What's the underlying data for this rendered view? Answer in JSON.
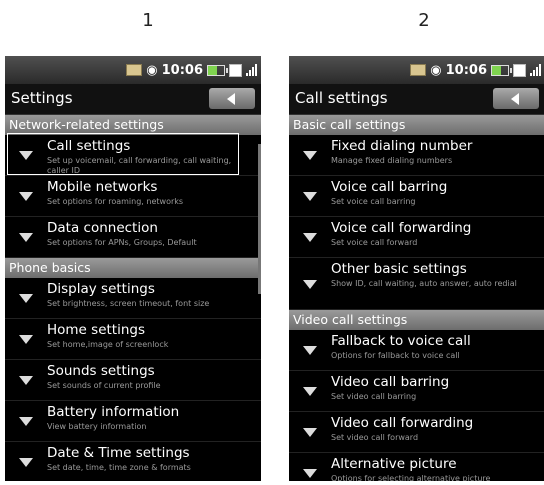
{
  "step_labels": [
    "1",
    "2"
  ],
  "status": {
    "time": "10:06",
    "battery_level": 0.55
  },
  "screens": [
    {
      "title": "Settings",
      "sections": [
        {
          "header": "Network-related settings",
          "items": [
            {
              "label": "Call settings",
              "sub": "Set up voicemail, call forwarding, call waiting, caller ID",
              "selected": true
            },
            {
              "label": "Mobile networks",
              "sub": "Set options for roaming, networks"
            },
            {
              "label": "Data connection",
              "sub": "Set options for APNs, Groups, Default"
            }
          ]
        },
        {
          "header": "Phone basics",
          "items": [
            {
              "label": "Display settings",
              "sub": "Set brightness, screen timeout, font size"
            },
            {
              "label": "Home settings",
              "sub": "Set home,image of screenlock"
            },
            {
              "label": "Sounds settings",
              "sub": "Set sounds of current profile"
            },
            {
              "label": "Battery information",
              "sub": "View battery information"
            },
            {
              "label": "Date & Time settings",
              "sub": "Set date, time, time zone & formats"
            }
          ]
        }
      ]
    },
    {
      "title": "Call settings",
      "sections": [
        {
          "header": "Basic call settings",
          "items": [
            {
              "label": "Fixed dialing number",
              "sub": "Manage fixed dialing numbers"
            },
            {
              "label": "Voice call barring",
              "sub": "Set voice call barring"
            },
            {
              "label": "Voice call forwarding",
              "sub": "Set voice call forward"
            },
            {
              "label": "Other basic settings",
              "sub": "Show ID, call waiting, auto answer, auto redial",
              "tall": true
            }
          ]
        },
        {
          "header": "Video call settings",
          "items": [
            {
              "label": "Fallback to voice call",
              "sub": "Options for fallback to voice call"
            },
            {
              "label": "Video call barring",
              "sub": "Set video call barring"
            },
            {
              "label": "Video call forwarding",
              "sub": "Set video call forward"
            },
            {
              "label": "Alternative picture",
              "sub": "Options for selecting alternative picture"
            }
          ]
        }
      ]
    }
  ]
}
